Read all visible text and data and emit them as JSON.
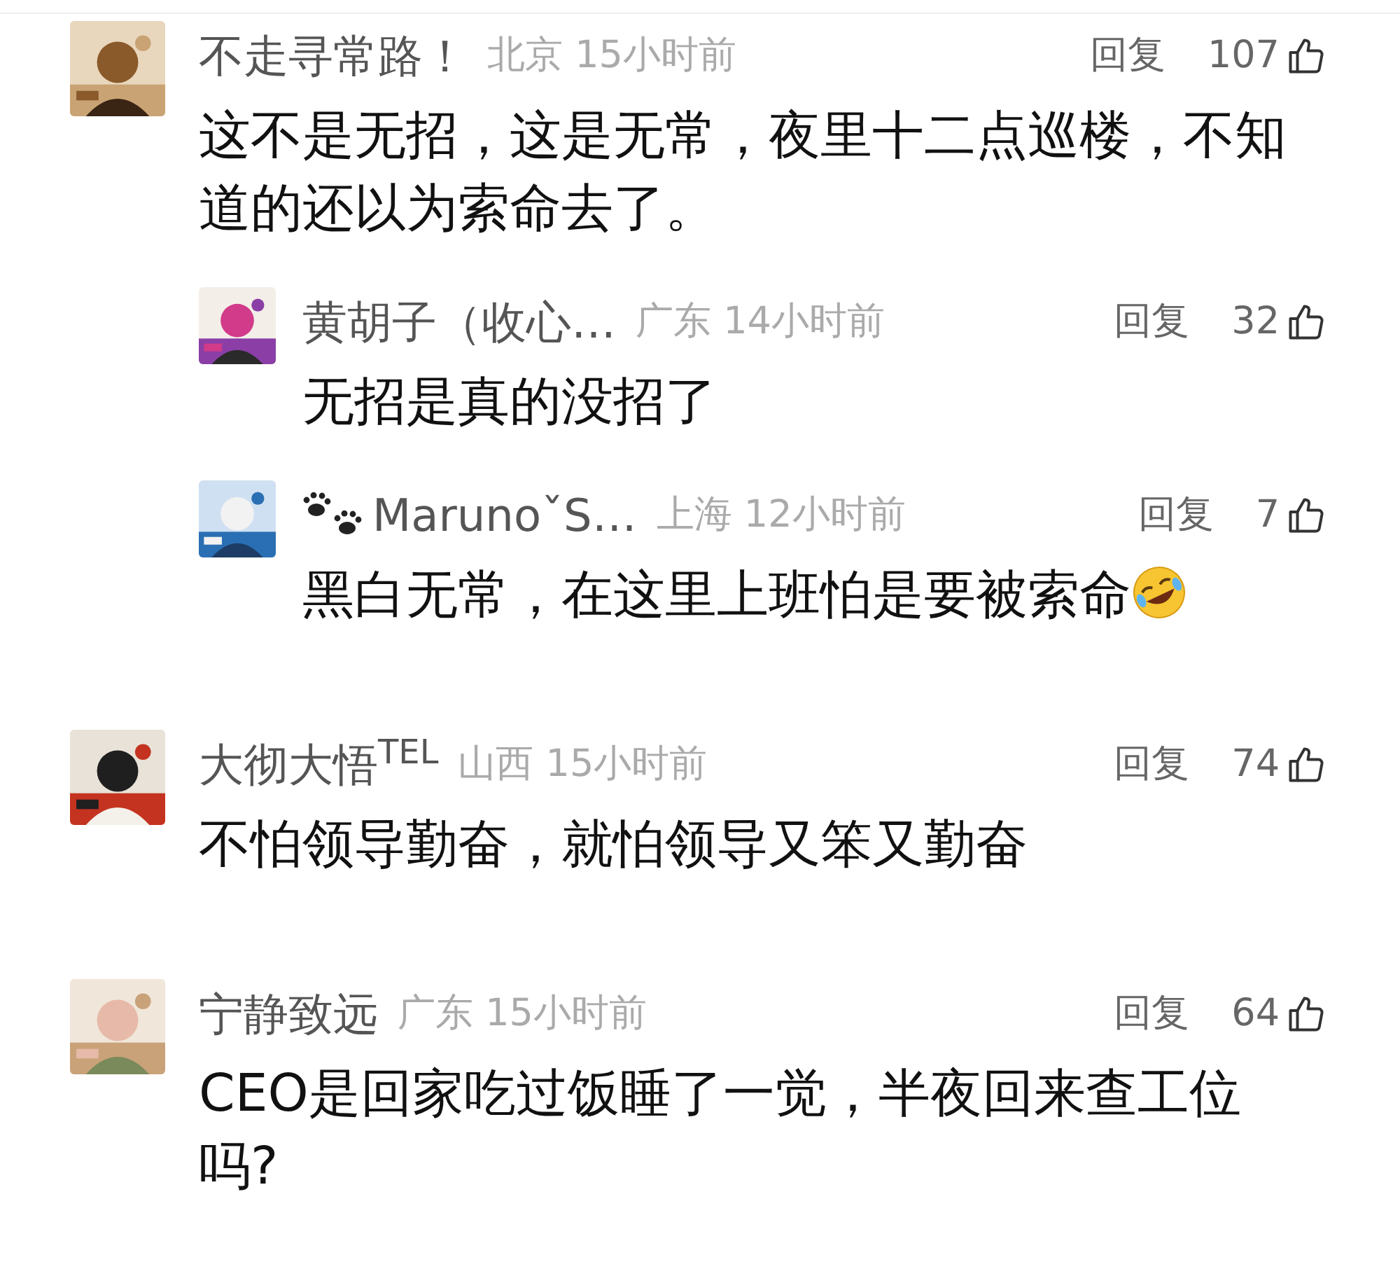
{
  "comments": [
    {
      "avatar": {
        "kind": "picture"
      },
      "name": "不走寻常路！",
      "location": "北京",
      "time": "15小时前",
      "reply": "回复",
      "likes": "107",
      "text": "这不是无招，这是无常，夜里十二点巡楼，不知道的还以为索命去了。",
      "children": [
        {
          "avatar": {
            "kind": "picture"
          },
          "name": "黄胡子（收心…",
          "location": "广东",
          "time": "14小时前",
          "reply": "回复",
          "likes": "32",
          "text": "无招是真的没招了"
        },
        {
          "avatar": {
            "kind": "picture"
          },
          "name_icon": true,
          "name": "MarunoˇS…",
          "location": "上海",
          "time": "12小时前",
          "reply": "回复",
          "likes": "7",
          "text": "黑白无常，在这里上班怕是要被索命",
          "emoji": true
        }
      ]
    },
    {
      "avatar": {
        "kind": "picture"
      },
      "name": "大彻大悟$^{TEL}$",
      "location": "山西",
      "time": "15小时前",
      "reply": "回复",
      "likes": "74",
      "text": "不怕领导勤奋，就怕领导又笨又勤奋"
    },
    {
      "avatar": {
        "kind": "picture"
      },
      "name": "宁静致远",
      "location": "广东",
      "time": "15小时前",
      "reply": "回复",
      "likes": "64",
      "text": "CEO是回家吃过饭睡了一觉，半夜回来查工位吗?"
    }
  ]
}
